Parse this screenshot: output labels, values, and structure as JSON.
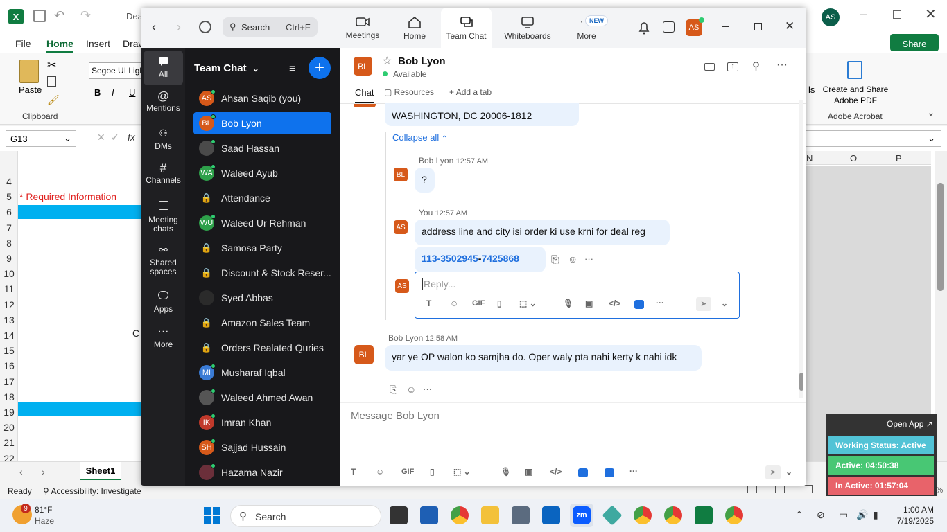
{
  "excel": {
    "title": "Dea",
    "menu": [
      "File",
      "Home",
      "Insert",
      "Draw"
    ],
    "paste": "Paste",
    "clipboard": "Clipboard",
    "font": "Segoe UI Ligh",
    "cell_ref": "G13",
    "fx": "fx",
    "required": "* Required Information",
    "col_headers": [
      "N",
      "O",
      "P"
    ],
    "rows": [
      "4",
      "5",
      "6",
      "7",
      "8",
      "9",
      "10",
      "11",
      "12",
      "13",
      "14",
      "15",
      "16",
      "17",
      "18",
      "19",
      "20",
      "21",
      "22"
    ],
    "cell_partial": "C",
    "sheet": "Sheet1",
    "status_ready": "Ready",
    "accessibility": "Accessibility: Investigate",
    "share": "Share",
    "adobe_create": "Create and Share Adobe PDF",
    "adobe_group": "Adobe Acrobat",
    "user_initials": "AS",
    "zoom_pct": "100%"
  },
  "zoom": {
    "search": {
      "placeholder": "Search",
      "shortcut": "Ctrl+F"
    },
    "tabs": [
      {
        "label": "Meetings"
      },
      {
        "label": "Home"
      },
      {
        "label": "Team Chat"
      },
      {
        "label": "Whiteboards"
      },
      {
        "label": "More",
        "badge": "NEW"
      }
    ],
    "user_initials": "AS",
    "rail": [
      "All",
      "Mentions",
      "DMs",
      "Channels",
      "Meeting chats",
      "Shared spaces",
      "Apps",
      "More"
    ],
    "list_title": "Team Chat",
    "list": [
      {
        "name": "Ahsan Saqib (you)",
        "initials": "AS",
        "color": "#d6591a",
        "online": true
      },
      {
        "name": "Bob Lyon",
        "initials": "BL",
        "color": "#d6591a",
        "online": true,
        "selected": true
      },
      {
        "name": "Saad Hassan",
        "initials": "",
        "color": "#4a4a4a",
        "online": true
      },
      {
        "name": "Waleed Ayub",
        "initials": "WA",
        "color": "#2ea04a",
        "online": true
      },
      {
        "name": "Attendance",
        "initials": "",
        "lock": true
      },
      {
        "name": "Waleed Ur Rehman",
        "initials": "WU",
        "color": "#2ea04a",
        "online": true
      },
      {
        "name": "Samosa Party",
        "initials": "",
        "lock": true
      },
      {
        "name": "Discount & Stock Reser...",
        "initials": "",
        "lock": true
      },
      {
        "name": "Syed Abbas",
        "initials": "",
        "color": "#2b2b2b",
        "online": false
      },
      {
        "name": "Amazon Sales Team",
        "initials": "",
        "lock": true
      },
      {
        "name": "Orders Realated Quries",
        "initials": "",
        "lock": true
      },
      {
        "name": "Musharaf Iqbal",
        "initials": "MI",
        "color": "#3a7bd5",
        "online": true
      },
      {
        "name": "Waleed Ahmed Awan",
        "initials": "",
        "color": "#555",
        "online": true
      },
      {
        "name": "Imran Khan",
        "initials": "IK",
        "color": "#c0392b",
        "online": true
      },
      {
        "name": "Sajjad Hussain",
        "initials": "SH",
        "color": "#d6591a",
        "online": true
      },
      {
        "name": "Hazama Nazir",
        "initials": "",
        "color": "#6b2f3a",
        "online": true
      }
    ],
    "chat": {
      "name": "Bob Lyon",
      "initials": "BL",
      "status": "Available",
      "tabs": [
        "Chat",
        "Resources",
        "Add a tab"
      ],
      "address": "WASHINGTON, DC 20006-1812",
      "collapse": "Collapse all",
      "messages": [
        {
          "sender": "Bob Lyon",
          "time": "12:57 AM",
          "text": "?"
        },
        {
          "sender": "You",
          "time": "12:57 AM",
          "text": "address line and city isi order ki use krni for deal reg"
        },
        {
          "link1": "113-3502945",
          "sep": "-",
          "link2": "7425868"
        },
        {
          "sender": "Bob Lyon",
          "time": "12:58 AM",
          "text": "yar ye OP walon ko samjha do. Oper waly pta nahi kerty k nahi idk"
        }
      ],
      "reply_placeholder": "Reply...",
      "message_placeholder": "Message Bob Lyon",
      "gif": "GIF"
    }
  },
  "widget": {
    "open_app": "Open App ↗",
    "status": "Working Status: Active",
    "active": "Active: 04:50:38",
    "inactive": "In Active: 01:57:04"
  },
  "taskbar": {
    "temp": "81°F",
    "weather": "Haze",
    "badge": "9",
    "search": "Search",
    "time": "1:00 AM",
    "date": "7/19/2025"
  }
}
